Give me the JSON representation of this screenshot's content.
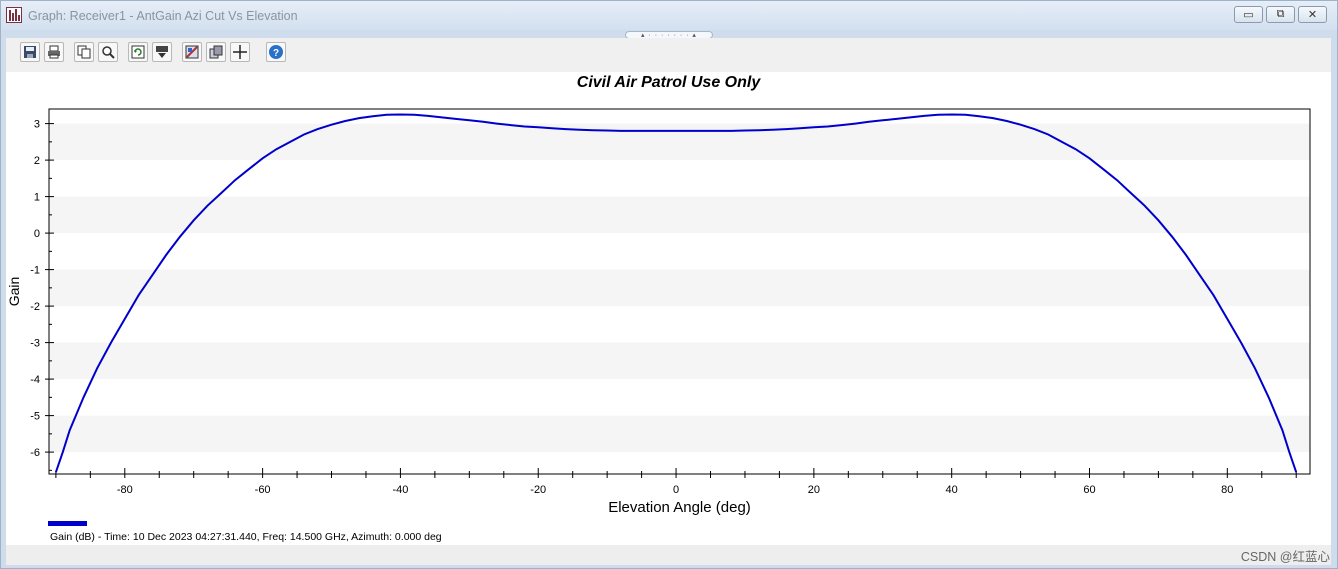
{
  "window": {
    "title": "Graph:  Receiver1 - AntGain Azi Cut Vs Elevation",
    "minimize_label": "▭",
    "restore_label": "⧉",
    "close_label": "✕"
  },
  "grip": {
    "label": "▴ · · · · · · · ▴"
  },
  "toolbar": {
    "buttons": [
      {
        "name": "save-button",
        "icon": "save-icon"
      },
      {
        "name": "print-button",
        "icon": "print-icon"
      },
      {
        "name": "copy-button",
        "icon": "copy-icon"
      },
      {
        "name": "zoom-button",
        "icon": "zoom-icon"
      },
      {
        "name": "refresh-button",
        "icon": "refresh-icon"
      },
      {
        "name": "export-button",
        "icon": "export-icon"
      },
      {
        "name": "properties-button",
        "icon": "properties-icon"
      },
      {
        "name": "layers-button",
        "icon": "layers-icon"
      },
      {
        "name": "crosshair-button",
        "icon": "crosshair-icon"
      },
      {
        "name": "help-button",
        "icon": "help-icon"
      }
    ]
  },
  "chart_data": {
    "type": "line",
    "title": "Civil Air Patrol Use Only",
    "xlabel": "Elevation Angle (deg)",
    "ylabel": "Gain",
    "xlim": [
      -91,
      92
    ],
    "ylim": [
      -6.6,
      3.4
    ],
    "xticks": [
      -80,
      -60,
      -40,
      -20,
      0,
      20,
      40,
      60,
      80
    ],
    "yticks": [
      3,
      2,
      1,
      0,
      -1,
      -2,
      -3,
      -4,
      -5,
      -6
    ],
    "grid": "alternating horizontal bands",
    "legend": "bottom-left",
    "series": [
      {
        "name": "Gain (dB) - Time: 10 Dec 2023 04:27:31.440, Freq: 14.500 GHz, Azimuth: 0.000 deg",
        "color": "#0000cc",
        "x": [
          -90,
          -89,
          -88,
          -86,
          -84,
          -82,
          -80,
          -78,
          -76,
          -74,
          -72,
          -70,
          -68,
          -66,
          -64,
          -62,
          -60,
          -58,
          -56,
          -54,
          -52,
          -50,
          -48,
          -46,
          -44,
          -42,
          -40,
          -38,
          -36,
          -34,
          -32,
          -30,
          -28,
          -26,
          -24,
          -22,
          -20,
          -18,
          -16,
          -14,
          -12,
          -10,
          -8,
          -6,
          -4,
          -2,
          0,
          2,
          4,
          6,
          8,
          10,
          12,
          14,
          16,
          18,
          20,
          22,
          24,
          26,
          28,
          30,
          32,
          34,
          36,
          38,
          40,
          42,
          44,
          46,
          48,
          50,
          52,
          54,
          56,
          58,
          60,
          62,
          64,
          66,
          68,
          70,
          72,
          74,
          76,
          78,
          80,
          82,
          84,
          86,
          88,
          89,
          90
        ],
        "y": [
          -6.55,
          -6.0,
          -5.4,
          -4.5,
          -3.7,
          -3.0,
          -2.35,
          -1.7,
          -1.15,
          -0.6,
          -0.1,
          0.35,
          0.75,
          1.1,
          1.45,
          1.75,
          2.05,
          2.3,
          2.5,
          2.7,
          2.85,
          2.97,
          3.07,
          3.15,
          3.2,
          3.24,
          3.25,
          3.24,
          3.21,
          3.17,
          3.13,
          3.09,
          3.05,
          3.0,
          2.96,
          2.92,
          2.9,
          2.87,
          2.85,
          2.83,
          2.82,
          2.81,
          2.8,
          2.8,
          2.8,
          2.8,
          2.8,
          2.8,
          2.8,
          2.8,
          2.8,
          2.81,
          2.82,
          2.83,
          2.85,
          2.87,
          2.9,
          2.92,
          2.96,
          3.0,
          3.05,
          3.09,
          3.13,
          3.17,
          3.21,
          3.24,
          3.25,
          3.24,
          3.2,
          3.15,
          3.07,
          2.97,
          2.85,
          2.7,
          2.5,
          2.3,
          2.05,
          1.75,
          1.45,
          1.1,
          0.75,
          0.35,
          -0.1,
          -0.6,
          -1.15,
          -1.7,
          -2.35,
          -3.0,
          -3.7,
          -4.5,
          -5.4,
          -6.0,
          -6.55
        ]
      }
    ]
  },
  "legend_label": "Gain (dB) - Time: 10 Dec 2023 04:27:31.440, Freq: 14.500 GHz, Azimuth: 0.000 deg",
  "watermark": "CSDN @红蓝心"
}
